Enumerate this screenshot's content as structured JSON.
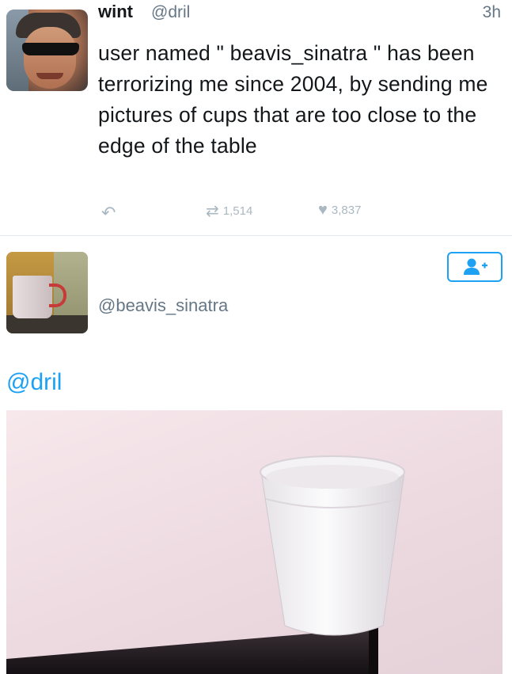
{
  "tweet": {
    "author_name": "wint",
    "author_handle": "@dril",
    "timestamp": "3h",
    "text": "user named \" beavis_sinatra \" has been terrorizing me since 2004, by sending me pictures of cups that are too close to the edge of the table",
    "retweet_count": "1,514",
    "like_count": "3,837",
    "icons": {
      "reply": "reply-icon",
      "retweet": "retweet-icon",
      "like": "heart-icon"
    }
  },
  "profile": {
    "handle": "@beavis_sinatra",
    "follow_icon": "add-user-icon"
  },
  "mention": {
    "text": "@dril"
  },
  "colors": {
    "link_blue": "#1da1f2",
    "muted_gray": "#657786",
    "icon_gray": "#aab8c2"
  }
}
